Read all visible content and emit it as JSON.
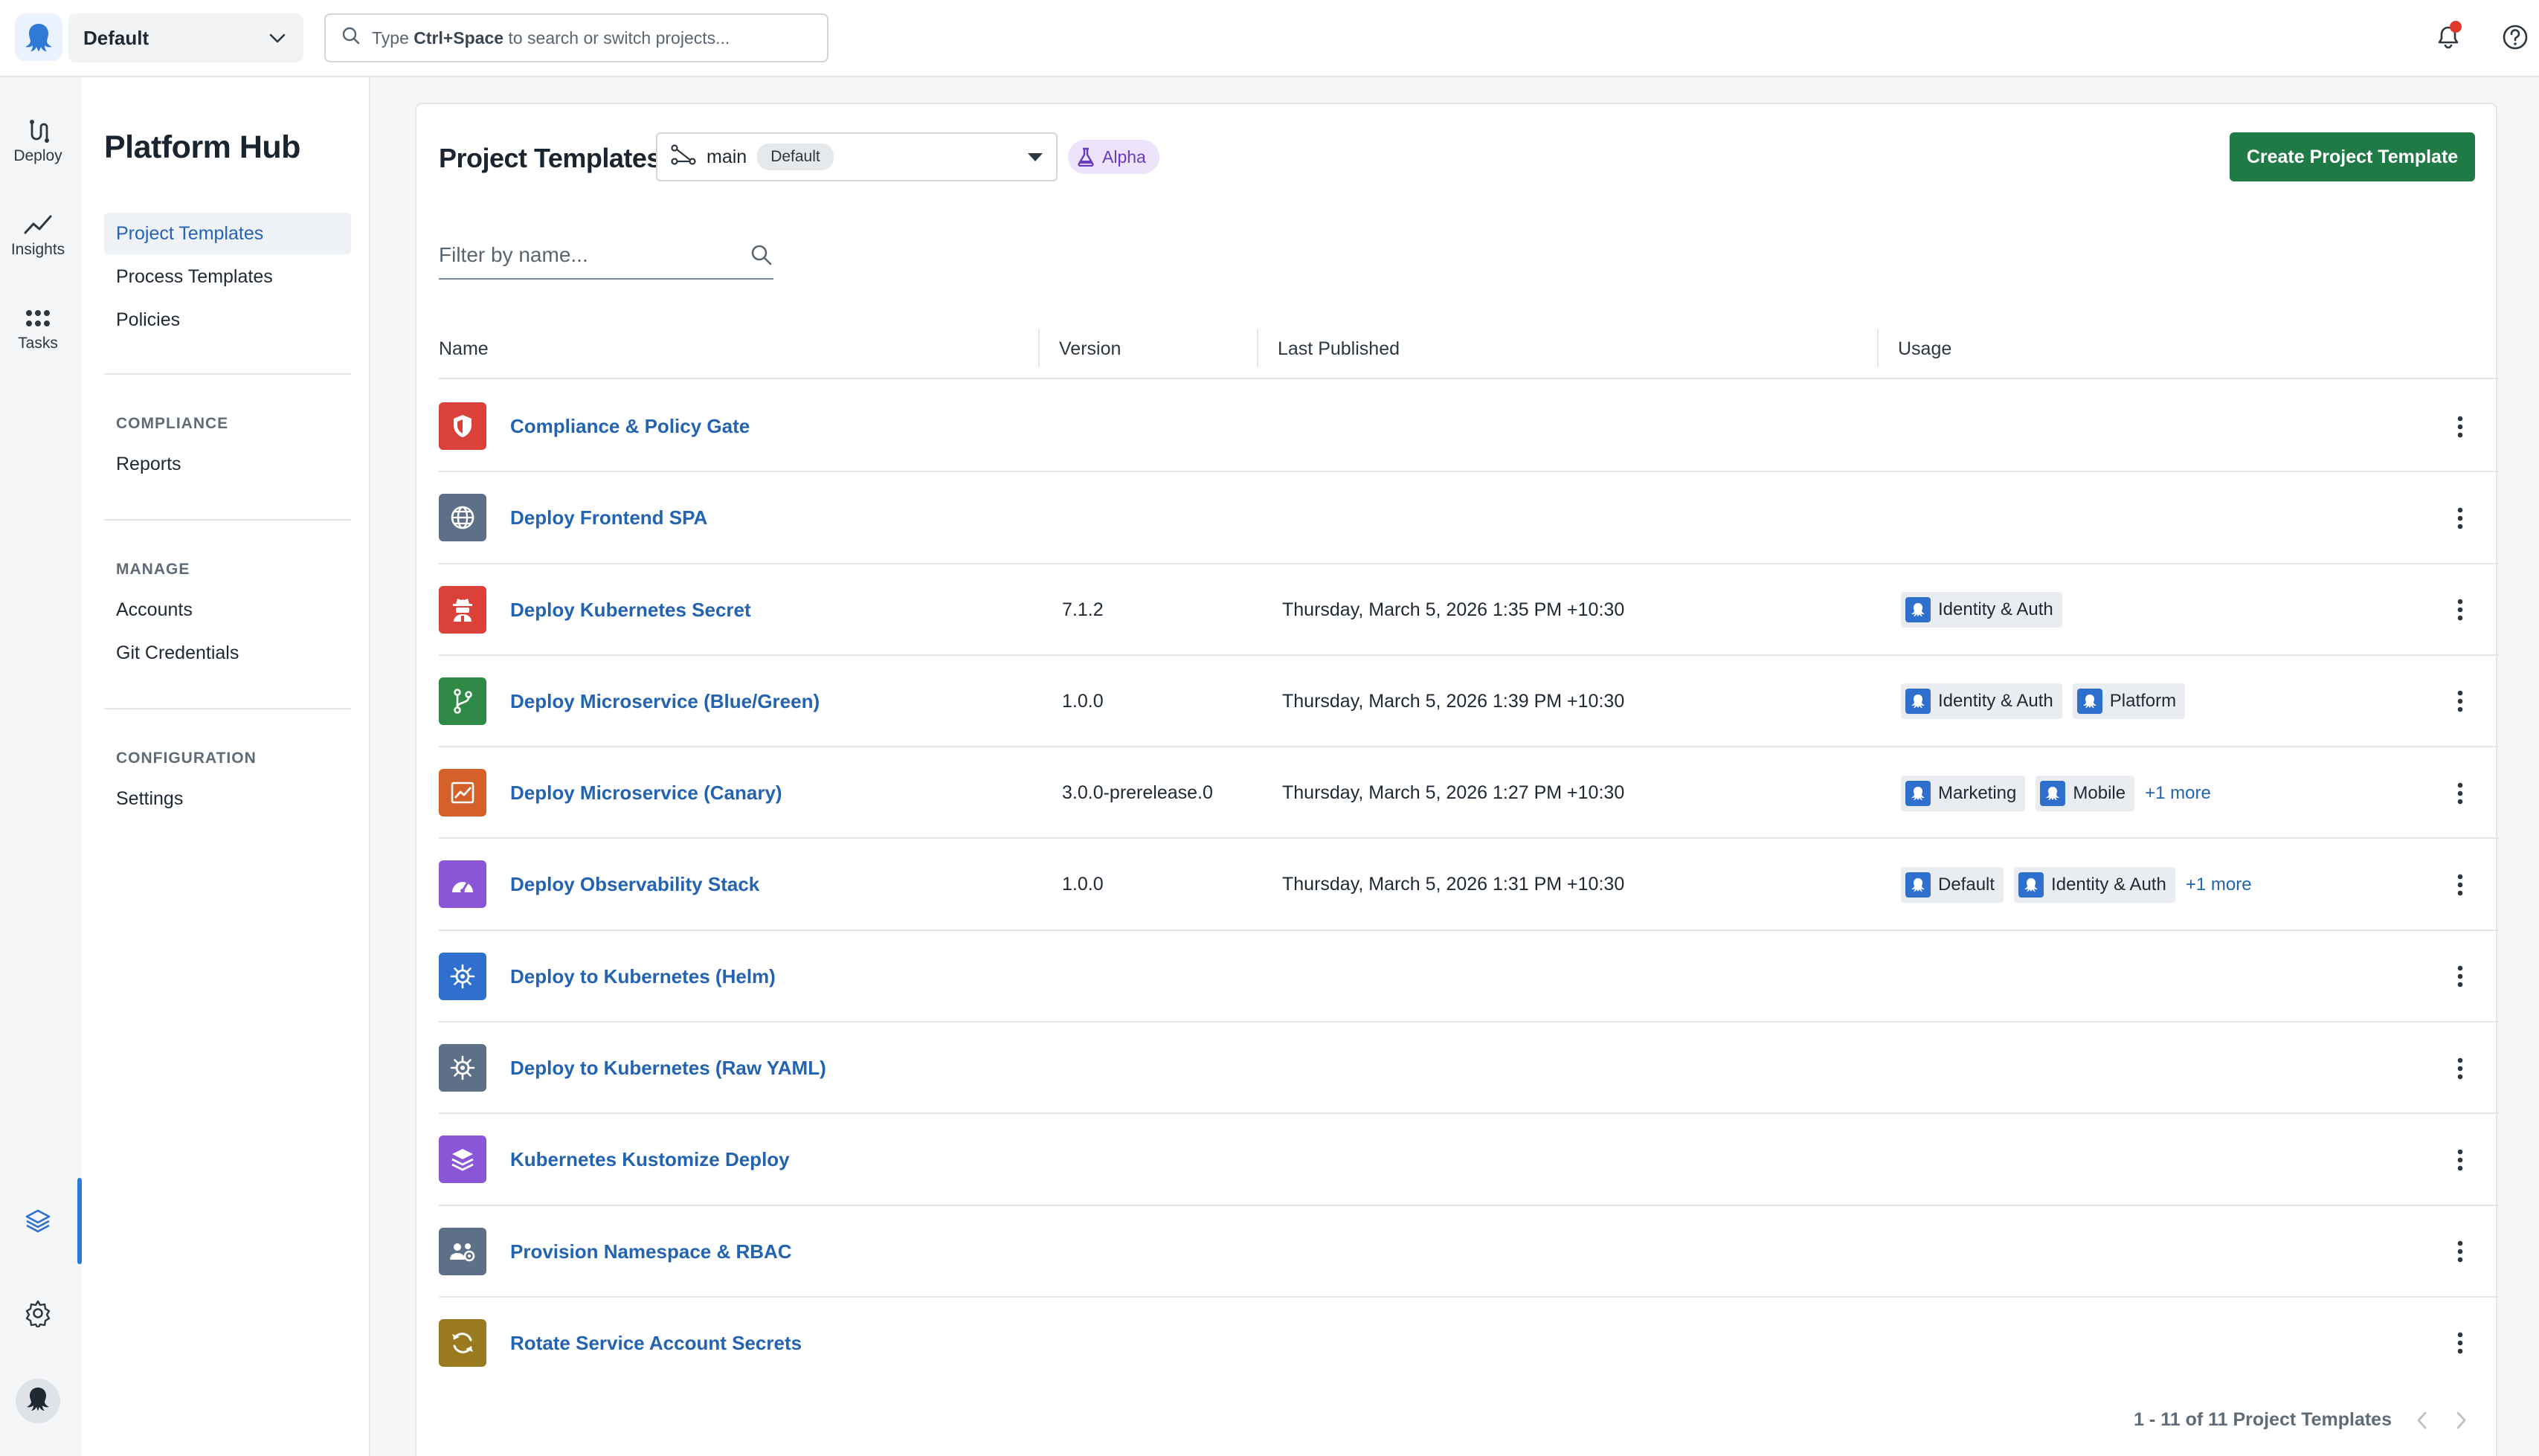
{
  "topbar": {
    "space_name": "Default",
    "search": {
      "prefix": "Type ",
      "shortcut": "Ctrl+Space",
      "suffix": " to search or switch projects..."
    }
  },
  "rail": {
    "items": [
      {
        "label": "Deploy",
        "icon": "deploy-icon"
      },
      {
        "label": "Insights",
        "icon": "insights-chart-icon"
      },
      {
        "label": "Tasks",
        "icon": "tasks-grid-icon"
      }
    ],
    "bottom_icons": [
      "platform-hub-layers-icon",
      "settings-gear-icon",
      "user-avatar-icon"
    ]
  },
  "sidenav": {
    "title": "Platform Hub",
    "links": [
      "Project Templates",
      "Process Templates",
      "Policies"
    ],
    "active_link": "Project Templates",
    "sections": [
      {
        "heading": "COMPLIANCE",
        "items": [
          "Reports"
        ]
      },
      {
        "heading": "MANAGE",
        "items": [
          "Accounts",
          "Git Credentials"
        ]
      },
      {
        "heading": "CONFIGURATION",
        "items": [
          "Settings"
        ]
      }
    ]
  },
  "main": {
    "title": "Project Templates",
    "branch": {
      "name": "main",
      "badge": "Default"
    },
    "alpha_label": "Alpha",
    "create_button": "Create Project Template",
    "filter_placeholder": "Filter by name...",
    "columns": [
      "Name",
      "Version",
      "Last Published",
      "Usage"
    ],
    "rows": [
      {
        "name": "Compliance & Policy Gate",
        "version": "",
        "published": "",
        "usage": [],
        "more": "",
        "icon": "shield-icon",
        "color": "#d9413a"
      },
      {
        "name": "Deploy Frontend SPA",
        "version": "",
        "published": "",
        "usage": [],
        "more": "",
        "icon": "globe-icon",
        "color": "#5e7087"
      },
      {
        "name": "Deploy Kubernetes Secret",
        "version": "7.1.2",
        "published": "Thursday, March 5, 2026 1:35 PM +10:30",
        "usage": [
          "Identity & Auth"
        ],
        "more": "",
        "icon": "secret-agent-icon",
        "color": "#d9413a"
      },
      {
        "name": "Deploy Microservice (Blue/Green)",
        "version": "1.0.0",
        "published": "Thursday, March 5, 2026 1:39 PM +10:30",
        "usage": [
          "Identity & Auth",
          "Platform"
        ],
        "more": "",
        "icon": "git-branch-icon",
        "color": "#2e8a44"
      },
      {
        "name": "Deploy Microservice (Canary)",
        "version": "3.0.0-prerelease.0",
        "published": "Thursday, March 5, 2026 1:27 PM +10:30",
        "usage": [
          "Marketing",
          "Mobile"
        ],
        "more": "+1 more",
        "icon": "chart-line-icon",
        "color": "#d4602a"
      },
      {
        "name": "Deploy Observability Stack",
        "version": "1.0.0",
        "published": "Thursday, March 5, 2026 1:31 PM +10:30",
        "usage": [
          "Default",
          "Identity & Auth"
        ],
        "more": "+1 more",
        "icon": "gauge-icon",
        "color": "#8a55d6"
      },
      {
        "name": "Deploy to Kubernetes (Helm)",
        "version": "",
        "published": "",
        "usage": [],
        "more": "",
        "icon": "helm-wheel-icon",
        "color": "#2f6fce"
      },
      {
        "name": "Deploy to Kubernetes (Raw YAML)",
        "version": "",
        "published": "",
        "usage": [],
        "more": "",
        "icon": "helm-wheel-icon",
        "color": "#5e7087"
      },
      {
        "name": "Kubernetes Kustomize Deploy",
        "version": "",
        "published": "",
        "usage": [],
        "more": "",
        "icon": "layers-icon",
        "color": "#8a55d6"
      },
      {
        "name": "Provision Namespace & RBAC",
        "version": "",
        "published": "",
        "usage": [],
        "more": "",
        "icon": "users-gear-icon",
        "color": "#5e7087"
      },
      {
        "name": "Rotate Service Account Secrets",
        "version": "",
        "published": "",
        "usage": [],
        "more": "",
        "icon": "rotate-icon",
        "color": "#9a7a1e"
      }
    ],
    "pagination": "1 - 11 of 11 Project Templates"
  }
}
